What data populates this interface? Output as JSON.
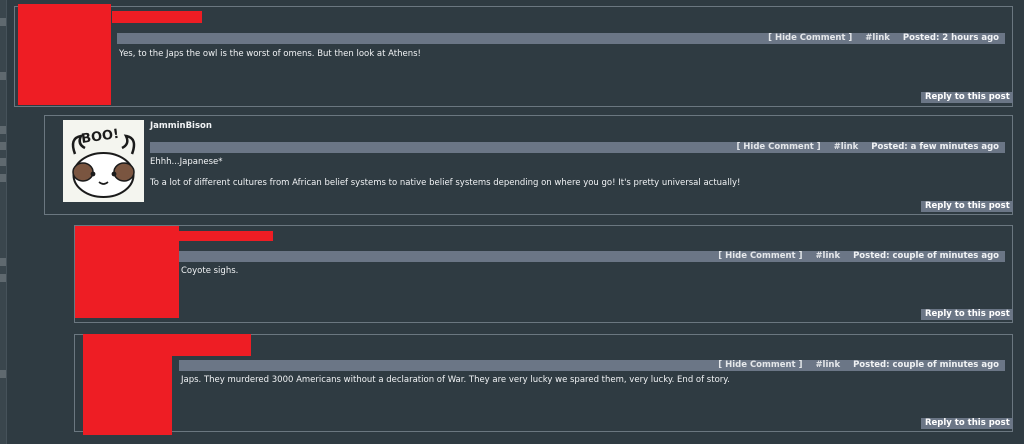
{
  "comments": [
    {
      "author": "",
      "hide_label": "[ Hide Comment ]",
      "link_label": "#link",
      "posted": "Posted: 2 hours ago",
      "body": [
        "Yes, to the Japs the owl is the worst of omens. But then look at Athens!"
      ],
      "reply_label": "Reply to this post",
      "redacted": true
    },
    {
      "author": "JamminBison",
      "hide_label": "[ Hide Comment ]",
      "link_label": "#link",
      "posted": "Posted: a few minutes ago",
      "body": [
        "Ehhh...Japanese*",
        "To a lot of different cultures from African belief systems to native belief systems depending on where you go! It's pretty universal actually!"
      ],
      "reply_label": "Reply to this post",
      "avatar": {
        "label": "BOO!",
        "icon": "cartoon-bison-icon"
      },
      "redacted": false
    },
    {
      "author": "",
      "hide_label": "[ Hide Comment ]",
      "link_label": "#link",
      "posted": "Posted: couple of minutes ago",
      "body": [
        "Coyote sighs."
      ],
      "reply_label": "Reply to this post",
      "redacted": true
    },
    {
      "author": "",
      "hide_label": "[ Hide Comment ]",
      "link_label": "#link",
      "posted": "Posted: couple of minutes ago",
      "body": [
        "Japs. They murdered 3000 Americans without a declaration of War. They are very lucky we spared them, very lucky. End of story."
      ],
      "reply_label": "Reply to this post",
      "redacted": true
    }
  ],
  "colors": {
    "background": "#2f3b42",
    "bar": "#6b7686",
    "redaction": "#ee1d24",
    "border": "#6b7780"
  }
}
